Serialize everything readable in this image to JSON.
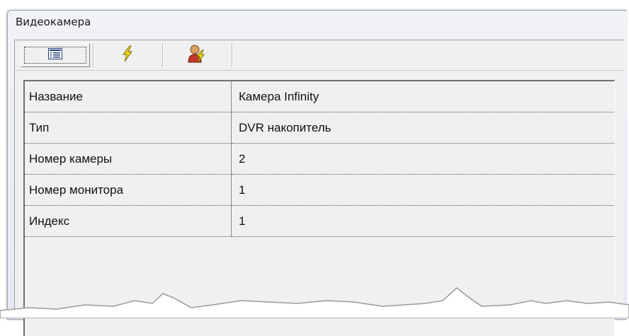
{
  "window": {
    "title": "Видеокамера"
  },
  "toolbar": {
    "buttons": [
      {
        "icon": "properties-list-icon",
        "selected": true
      },
      {
        "icon": "lightning-icon",
        "selected": false
      },
      {
        "icon": "user-lightning-icon",
        "selected": false
      }
    ]
  },
  "properties": [
    {
      "name": "Название",
      "value": "Камера Infinity"
    },
    {
      "name": "Тип",
      "value": "DVR накопитель"
    },
    {
      "name": "Номер камеры",
      "value": "2"
    },
    {
      "name": "Номер монитора",
      "value": "1"
    },
    {
      "name": "Индекс",
      "value": "1"
    }
  ],
  "colors": {
    "window_bg": "#e6e9f2",
    "panel_bg": "#f0f0f0",
    "lightning": "#f2d51a"
  }
}
